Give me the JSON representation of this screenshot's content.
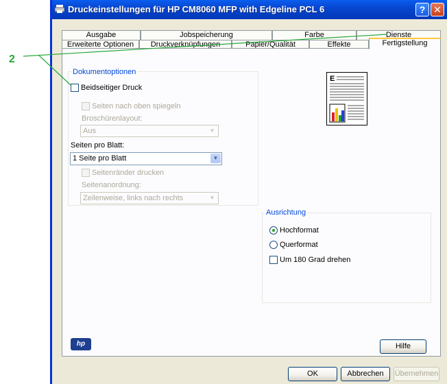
{
  "window": {
    "title": "Druckeinstellungen für HP CM8060 MFP with Edgeline PCL 6",
    "help_glyph": "?",
    "close_glyph": "✕"
  },
  "callout_number": "2",
  "tabs_back": [
    "Ausgabe",
    "Jobspeicherung",
    "Farbe",
    "Dienste"
  ],
  "tabs_front": [
    "Erweiterte Optionen",
    "Druckverknüpfungen",
    "Papier/Qualität",
    "Effekte",
    "Fertigstellung"
  ],
  "active_tab": "Fertigstellung",
  "document_options": {
    "group_title": "Dokumentoptionen",
    "duplex_label": "Beidseitiger Druck",
    "mirror_label": "Seiten nach oben spiegeln",
    "booklet_label": "Broschürenlayout:",
    "booklet_value": "Aus",
    "pages_per_sheet_label": "Seiten pro Blatt:",
    "pages_per_sheet_value": "1 Seite pro Blatt",
    "print_borders_label": "Seitenränder drucken",
    "page_order_label": "Seitenanordnung:",
    "page_order_value": "Zeilenweise, links nach rechts"
  },
  "orientation": {
    "group_title": "Ausrichtung",
    "portrait": "Hochformat",
    "landscape": "Querformat",
    "rotate": "Um 180 Grad drehen",
    "selected": "Hochformat"
  },
  "buttons": {
    "help": "Hilfe",
    "ok": "OK",
    "cancel": "Abbrechen",
    "apply": "Übernehmen"
  },
  "logo_text": "hp",
  "colors": {
    "accent_tab": "#ffc83c",
    "callout": "#27a83a",
    "titlebar": "#0846d0"
  }
}
